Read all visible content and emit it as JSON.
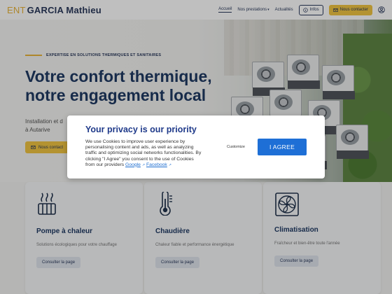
{
  "header": {
    "logo_prefix": "ENT",
    "logo_name": "GARCIA Mathieu",
    "nav": [
      {
        "label": "Accueil"
      },
      {
        "label": "Nos prestations"
      },
      {
        "label": "Actualités"
      }
    ],
    "infos_label": "Infos",
    "contact_label": "Nous contacter"
  },
  "hero": {
    "tagline": "EXPERTISE EN SOLUTIONS THERMIQUES ET SANITAIRES",
    "title": "Votre confort thermique, notre engagement local",
    "subtitle_line1": "Installation et d",
    "subtitle_line2": "à Autarive",
    "button_label": "Nous contact"
  },
  "cards": [
    {
      "title": "Pompe à chaleur",
      "desc": "Solutions écologiques pour votre chauffage",
      "button": "Consulter la page",
      "icon": "heat-pump-icon"
    },
    {
      "title": "Chaudière",
      "desc": "Chaleur fiable et performance énergétique",
      "button": "Consulter la page",
      "icon": "thermometer-icon"
    },
    {
      "title": "Climatisation",
      "desc": "Fraîcheur et bien-être toute l'année",
      "button": "Consulter la page",
      "icon": "fan-icon"
    }
  ],
  "consent": {
    "title": "Your privacy is our priority",
    "text": "We use Cookies to improve user experience by personalising content and ads, as well as analyzing traffic and optimizing social networks functionalities. By clicking \"I Agree\" you consent to the use of Cookies from our providers",
    "link_google": "Google",
    "link_facebook": "Facebook",
    "customize_label": "Customize",
    "agree_label": "I AGREE"
  },
  "colors": {
    "accent": "#f0c542",
    "brand": "#1f3a63",
    "agree_button": "#1e6fd6"
  }
}
